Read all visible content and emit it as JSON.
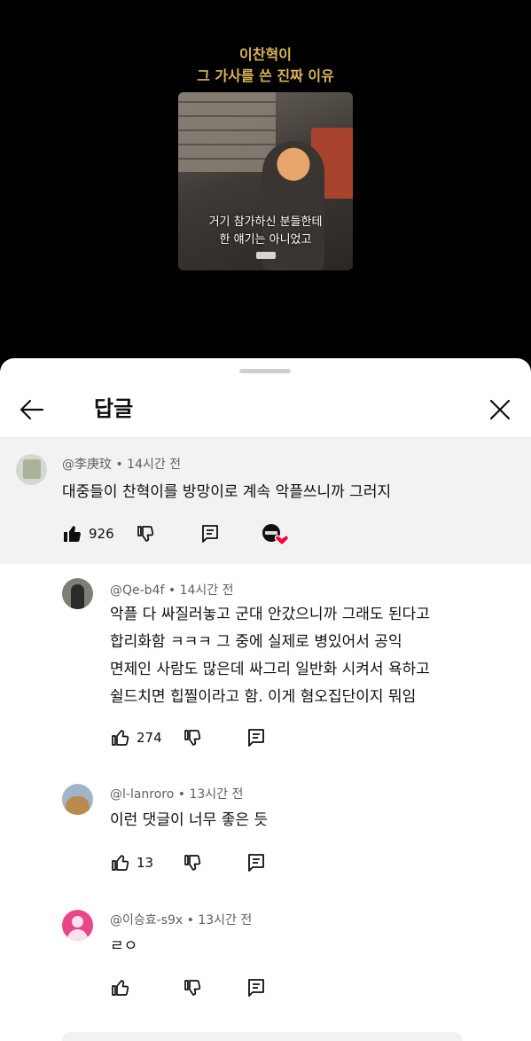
{
  "video": {
    "title_line1": "이찬혁이",
    "title_line2": "그 가사를 쓴 진짜 이유",
    "subtitle_line1": "거기 참가하신 분들한테",
    "subtitle_line2": "한 얘기는 아니었고"
  },
  "header": {
    "title": "답글"
  },
  "parent_comment": {
    "author": "@李庚玟",
    "time": "• 14시간 전",
    "text": "대중들이 찬혁이를 방망이로 계속 악플쓰니까 그러지",
    "likes": "926"
  },
  "replies": [
    {
      "author": "@Qe-b4f",
      "time": "• 14시간 전",
      "lines": [
        "악플 다 싸질러놓고 군대 안갔으니까 그래도 된다고",
        "합리화함 ㅋㅋㅋ 그 중에 실제로 병있어서 공익",
        "면제인 사람도 많은데 싸그리 일반화 시켜서 욕하고",
        "쉴드치면 힙찔이라고 함. 이게 혐오집단이지 뭐임"
      ],
      "likes": "274"
    },
    {
      "author": "@l-lanroro",
      "time": "• 13시간 전",
      "lines": [
        "이런 댓글이 너무 좋은 듯"
      ],
      "likes": "13"
    },
    {
      "author": "@이승효-s9x",
      "time": "• 13시간 전",
      "lines": [
        "ㄹㅇ"
      ],
      "likes": ""
    }
  ],
  "icons": {
    "back": "arrow-left-icon",
    "close": "close-icon",
    "like": "thumbs-up-icon",
    "dislike": "thumbs-down-icon",
    "reply": "reply-icon",
    "creator_heart": "creator-heart-icon"
  },
  "colors": {
    "title_gold": "#d9b35a",
    "parent_bg": "#f2f2f2",
    "heart_red": "#ff0033"
  }
}
